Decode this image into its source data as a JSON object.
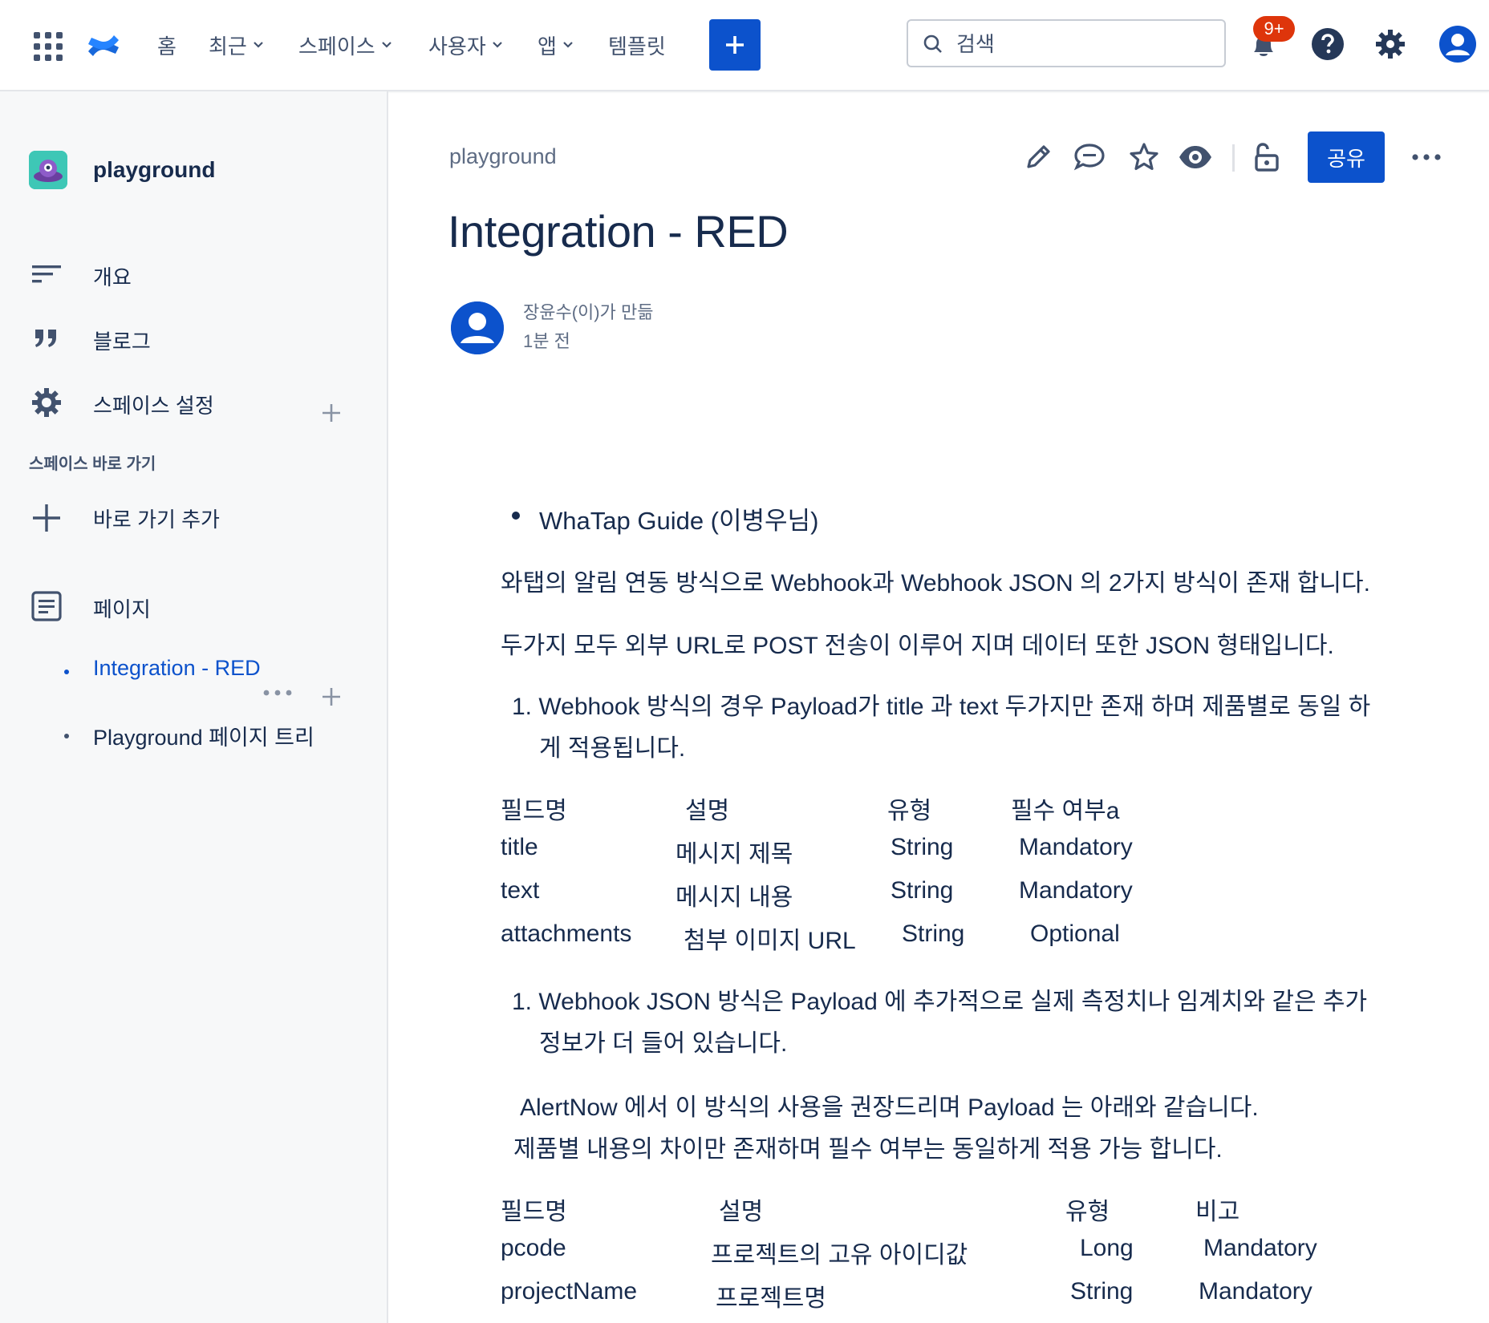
{
  "nav": {
    "items": [
      "홈",
      "최근",
      "스페이스",
      "사용자",
      "앱",
      "템플릿"
    ],
    "search_placeholder": "검색",
    "notification_count": "9+",
    "colors": {
      "accent": "#0c52cc",
      "badge": "#de350b",
      "text": "#42526e"
    }
  },
  "sidebar": {
    "space_name": "playground",
    "items": [
      "개요",
      "블로그",
      "스페이스 설정"
    ],
    "shortcuts_heading": "스페이스 바로 가기",
    "add_shortcut": "바로 가기 추가",
    "pages_label": "페이지",
    "tree": [
      "Integration - RED",
      "Playground 페이지 트리"
    ]
  },
  "page": {
    "breadcrumb": "playground",
    "share_label": "공유",
    "title": "Integration - RED",
    "byline": "장윤수(이)가 만듦",
    "time": "1분 전"
  },
  "content": {
    "bullet": "WhaTap Guide (이병우님)",
    "p1": "와탭의 알림 연동 방식으로 Webhook과 Webhook JSON 의 2가지 방식이 존재 합니다.",
    "p2": "두가지 모두 외부 URL로 POST 전송이 이루어 지며 데이터 또한 JSON 형태입니다.",
    "ol1_line1": "1. Webhook 방식의 경우 Payload가 title 과 text 두가지만 존재 하며 제품별로 동일 하",
    "ol1_line2": "게 적용됩니다.",
    "table1": {
      "headers": [
        "필드명",
        "설명",
        "유형",
        "필수 여부a"
      ],
      "rows": [
        [
          "title",
          "메시지 제목",
          "String",
          "Mandatory"
        ],
        [
          "text",
          "메시지 내용",
          "String",
          "Mandatory"
        ],
        [
          "attachments",
          "첨부 이미지 URL",
          "String",
          "Optional"
        ]
      ]
    },
    "ol2_line1": "1. Webhook JSON 방식은 Payload 에 추가적으로 실제 측정치나 임계치와 같은 추가",
    "ol2_line2": "정보가 더 들어 있습니다.",
    "p3": "AlertNow 에서 이 방식의 사용을 권장드리며 Payload 는 아래와 같습니다.",
    "p4": "제품별 내용의 차이만 존재하며 필수 여부는 동일하게 적용 가능 합니다.",
    "table2": {
      "headers": [
        "필드명",
        "설명",
        "유형",
        "비고"
      ],
      "rows": [
        [
          "pcode",
          "프로젝트의 고유 아이디값",
          "Long",
          "Mandatory"
        ],
        [
          "projectName",
          "프로젝트명",
          "String",
          "Mandatory"
        ]
      ]
    }
  }
}
